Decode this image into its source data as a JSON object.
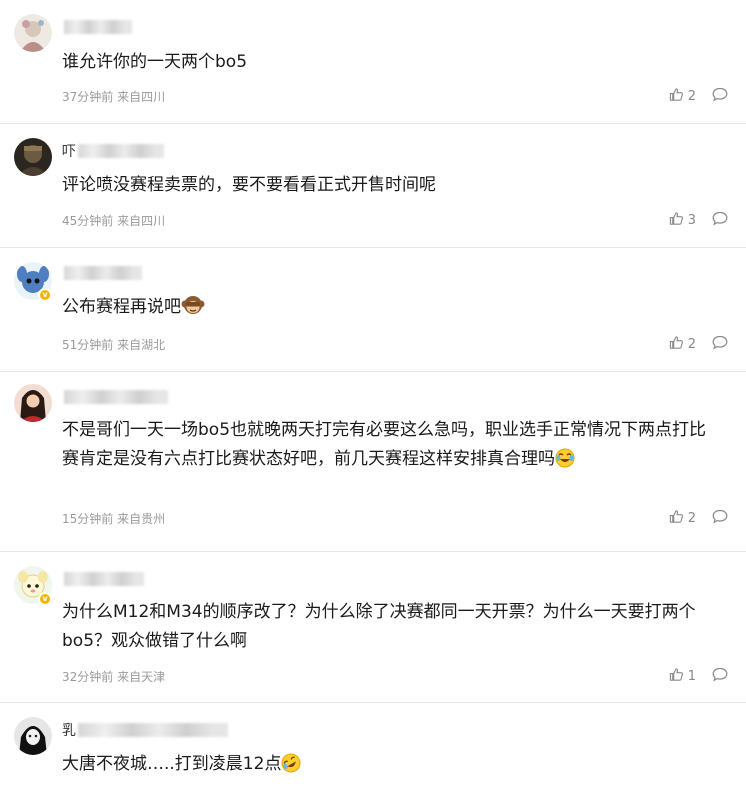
{
  "comments": [
    {
      "name_visible": "",
      "text": "谁允许你的一天两个bo5",
      "time": "37分钟前",
      "location": "来自四川",
      "likes": "2",
      "verified": false,
      "emoji": ""
    },
    {
      "name_visible": "吓",
      "text": "评论喷没赛程卖票的，要不要看看正式开售时间呢",
      "time": "45分钟前",
      "location": "来自四川",
      "likes": "3",
      "verified": false,
      "emoji": ""
    },
    {
      "name_visible": "",
      "text": "公布赛程再说吧",
      "time": "51分钟前",
      "location": "来自湖北",
      "likes": "2",
      "verified": true,
      "emoji": "monkey-emoji"
    },
    {
      "name_visible": "",
      "text": "不是哥们一天一场bo5也就晚两天打完有必要这么急吗，职业选手正常情况下两点打比赛肯定是没有六点打比赛状态好吧，前几天赛程这样安排真合理吗",
      "time": "15分钟前",
      "location": "来自贵州",
      "likes": "2",
      "verified": false,
      "emoji": "laugh-cry-emoji"
    },
    {
      "name_visible": "",
      "text": "为什么M12和M34的顺序改了？为什么除了决赛都同一天开票？为什么一天要打两个bo5？观众做错了什么啊",
      "time": "32分钟前",
      "location": "来自天津",
      "likes": "1",
      "verified": true,
      "emoji": ""
    },
    {
      "name_visible": "乳",
      "text": "大唐不夜城…..打到凌晨12点",
      "time": "",
      "location": "",
      "likes": "",
      "verified": false,
      "emoji": "rofl-emoji"
    }
  ],
  "icons": {
    "like": "thumbs-up-icon",
    "reply": "comment-bubble-icon"
  },
  "colors": {
    "text": "#1a1a1a",
    "meta": "#9a9a9a",
    "divider": "#e8e8e8",
    "badge": "#f5b400"
  }
}
